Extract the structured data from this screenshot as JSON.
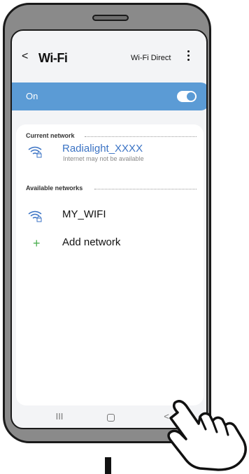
{
  "header": {
    "back_label": "<",
    "title": "Wi-Fi",
    "wifi_direct": "Wi-Fi Direct"
  },
  "toggle_bar": {
    "label": "On",
    "state": "on",
    "color": "#5b9bd5"
  },
  "current_section": {
    "label": "Current network"
  },
  "current_network": {
    "name": "Radialight_XXXX",
    "status": "Internet may not be available",
    "name_color": "#3b73c4"
  },
  "available_section": {
    "label": "Available networks"
  },
  "available_networks": [
    {
      "name": "MY_WIFI"
    }
  ],
  "add_network": {
    "icon": "+",
    "label": "Add network",
    "icon_color": "#4caf50"
  },
  "navbar": {
    "recent": "III",
    "back": "<"
  },
  "icons": {
    "hand": "pointing-hand-icon",
    "wifi": "wifi-lock-icon",
    "more": "more-vert-icon"
  }
}
